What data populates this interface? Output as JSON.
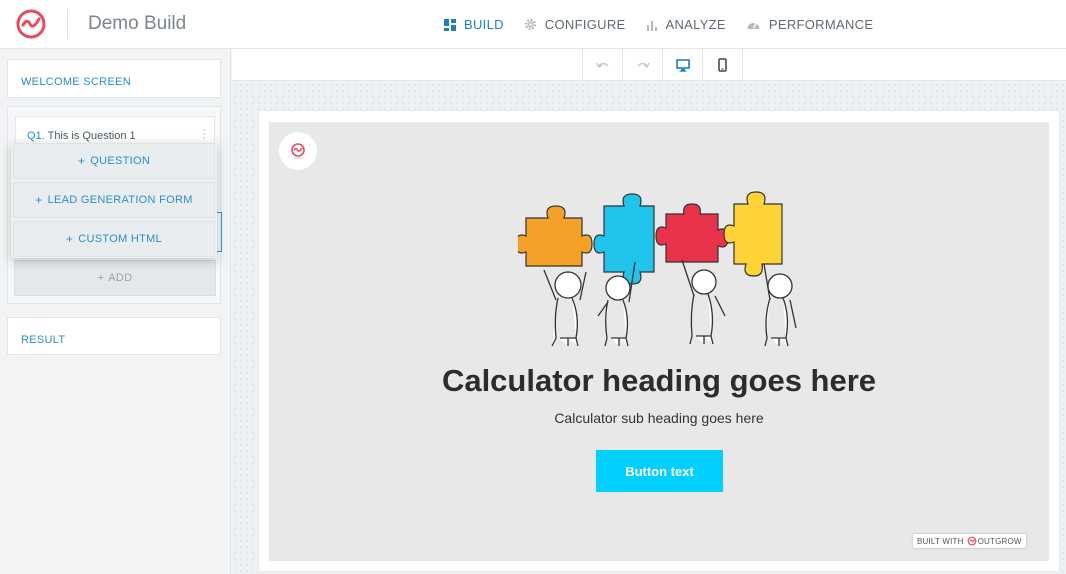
{
  "app": {
    "title": "Demo Build"
  },
  "nav": {
    "items": [
      {
        "label": "BUILD",
        "icon": "grid-icon",
        "active": true
      },
      {
        "label": "CONFIGURE",
        "icon": "gear-icon",
        "active": false
      },
      {
        "label": "ANALYZE",
        "icon": "bar-chart-icon",
        "active": false
      },
      {
        "label": "PERFORMANCE",
        "icon": "speedometer-icon",
        "active": false
      }
    ]
  },
  "sidebar": {
    "welcome": "WELCOME SCREEN",
    "question": {
      "number": "Q1.",
      "text": "This is Question 1"
    },
    "add": "ADD",
    "result": "RESULT"
  },
  "popup": {
    "items": [
      {
        "label": "QUESTION"
      },
      {
        "label": "LEAD GENERATION FORM"
      },
      {
        "label": "CUSTOM HTML"
      }
    ]
  },
  "toolbar": {
    "tools": [
      "undo-icon",
      "redo-icon",
      "desktop-icon",
      "mobile-icon"
    ],
    "active_tool": "desktop-icon"
  },
  "preview": {
    "heading": "Calculator heading goes here",
    "subheading": "Calculator sub heading goes here",
    "button": "Button text",
    "built_with": "BUILT WITH",
    "brand": "OUTGROW"
  },
  "colors": {
    "accent": "#1f7fbf",
    "cta": "#00cfff",
    "logo": "#e84a5f"
  }
}
